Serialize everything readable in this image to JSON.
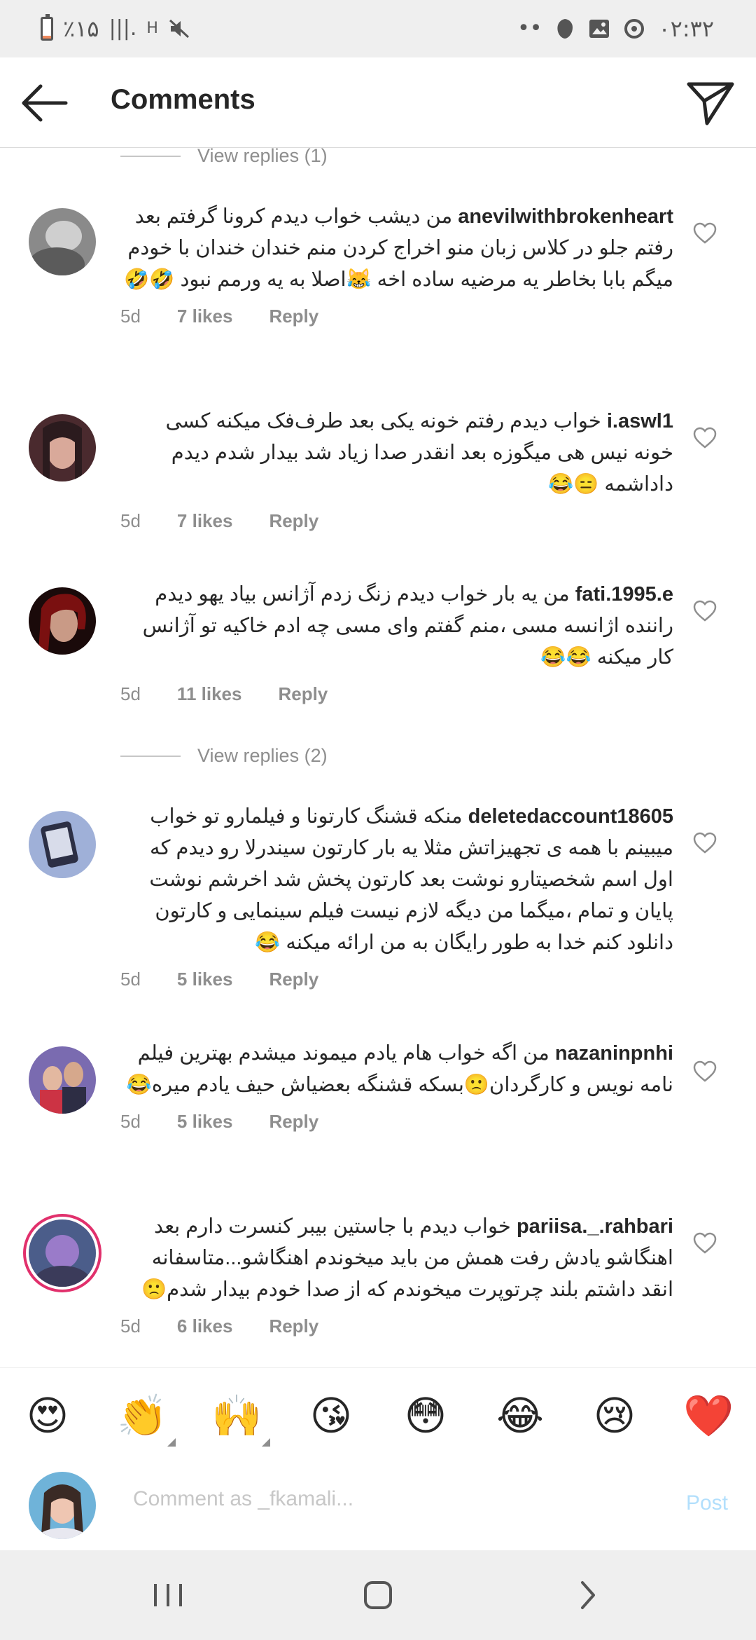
{
  "status_bar": {
    "battery_text": "٪۱۵",
    "battery_level": 0.15,
    "signal_glyph": "|||.",
    "network_type": "H",
    "time": "۰۲:۳۲",
    "icons": [
      "battery-icon",
      "signal-icon",
      "data-arrows-icon",
      "mute-icon",
      "more-dots-icon",
      "vpn-icon",
      "gallery-icon",
      "data-saver-icon"
    ]
  },
  "header": {
    "title": "Comments",
    "back_icon": "arrow-left-icon",
    "direct_icon": "paper-plane-icon"
  },
  "view_replies": [
    {
      "label": "View replies (1)"
    },
    {
      "label": "View replies (2)"
    }
  ],
  "comments": [
    {
      "username": "anevilwithbrokenheart",
      "text": "من دیشب خواب دیدم کرونا گرفتم بعد رفتم جلو در کلاس زبان منو اخراج کردن منم خندان خندان با خودم میگم بابا بخاطر یه مرضیه ساده اخه 😹اصلا به یه ورمم نبود 🤣🤣",
      "age": "5d",
      "likes": "7 likes",
      "reply": "Reply"
    },
    {
      "username": "i.aswl1",
      "text": "خواب دیدم رفتم خونه یکی بعد طرف‌فک میکنه کسی خونه نیس هی میگوزه بعد انقدر صدا زیاد شد بیدار شدم دیدم داداشمه 😑😂",
      "age": "5d",
      "likes": "7 likes",
      "reply": "Reply"
    },
    {
      "username": "fati.1995.e",
      "text": "من یه بار خواب دیدم زنگ زدم آژانس بیاد یهو دیدم راننده اژانسه مسی ،منم گفتم وای مسی چه ادم خاکیه تو آژانس کار میکنه 😂😂",
      "age": "5d",
      "likes": "11 likes",
      "reply": "Reply"
    },
    {
      "username": "deletedaccount18605",
      "text": "منکه قشنگ کارتونا و فیلمارو تو خواب میبینم با همه ی تجهیزاتش مثلا یه بار کارتون سیندرلا رو دیدم که اول اسم شخصیتارو نوشت بعد کارتون پخش شد اخرشم نوشت پایان و تمام ،میگما من دیگه لازم نیست فیلم سینمایی و کارتون دانلود کنم خدا به طور رایگان به من ارائه میکنه 😂",
      "age": "5d",
      "likes": "5 likes",
      "reply": "Reply"
    },
    {
      "username": "nazaninpnhi",
      "text": "من اگه خواب هام یادم میموند میشدم بهترین فیلم نامه نویس و کارگردان🙁بسکه قشنگه بعضیاش حیف یادم میره😂",
      "age": "5d",
      "likes": "5 likes",
      "reply": "Reply"
    },
    {
      "username": "pariisa._.rahbari",
      "text": "خواب دیدم با جاستین بیبر کنسرت دارم بعد اهنگاشو یادش رفت همش من باید میخوندم اهنگاشو...متاسفانه انقد داشتم بلند چرتوپرت میخوندم که از صدا خودم بیدار شدم🙁",
      "age": "5d",
      "likes": "6 likes",
      "reply": "Reply"
    }
  ],
  "emoji_bar": [
    "😍",
    "👏",
    "🙌",
    "😘",
    "😳",
    "😂",
    "😢",
    "❤️"
  ],
  "composer": {
    "placeholder": "Comment as _fkamali...",
    "post_label": "Post"
  },
  "nav_bar": {
    "icons": [
      "recent-apps-icon",
      "home-icon",
      "back-icon"
    ]
  },
  "colors": {
    "link_blue": "#b2dffc",
    "meta_gray": "#8e8e8e",
    "story_ring": "#e1306c",
    "heart_red": "#ed4956"
  }
}
